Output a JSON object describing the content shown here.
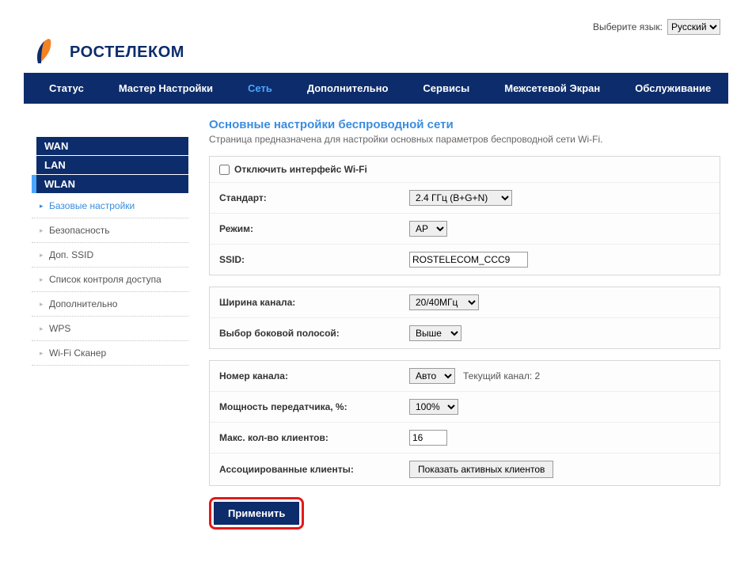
{
  "lang": {
    "label": "Выберите язык:",
    "selected": "Русский"
  },
  "brand": "РОСТЕЛЕКОМ",
  "nav": {
    "status": "Статус",
    "wizard": "Мастер Настройки",
    "network": "Сеть",
    "advanced": "Дополнительно",
    "services": "Сервисы",
    "firewall": "Межсетевой Экран",
    "maintenance": "Обслуживание"
  },
  "sidebar": {
    "wan": "WAN",
    "lan": "LAN",
    "wlan": "WLAN",
    "items": [
      "Базовые настройки",
      "Безопасность",
      "Доп. SSID",
      "Список контроля доступа",
      "Дополнительно",
      "WPS",
      "Wi-Fi Сканер"
    ]
  },
  "page": {
    "title": "Основные настройки беспроводной сети",
    "desc": "Страница предназначена для настройки основных параметров беспроводной сети Wi-Fi."
  },
  "panel1": {
    "disable_label": "Отключить интерфейс Wi-Fi",
    "standard_label": "Стандарт:",
    "standard_value": "2.4 ГГц (B+G+N)",
    "mode_label": "Режим:",
    "mode_value": "AP",
    "ssid_label": "SSID:",
    "ssid_value": "ROSTELECOM_CCC9"
  },
  "panel2": {
    "width_label": "Ширина канала:",
    "width_value": "20/40МГц",
    "sideband_label": "Выбор боковой полосой:",
    "sideband_value": "Выше"
  },
  "panel3": {
    "channel_label": "Номер канала:",
    "channel_value": "Авто",
    "channel_note": "Текущий канал: 2",
    "power_label": "Мощность передатчика, %:",
    "power_value": "100%",
    "maxclients_label": "Макс. кол-во клиентов:",
    "maxclients_value": "16",
    "assoc_label": "Ассоциированные клиенты:",
    "assoc_button": "Показать активных клиентов"
  },
  "apply": "Применить"
}
